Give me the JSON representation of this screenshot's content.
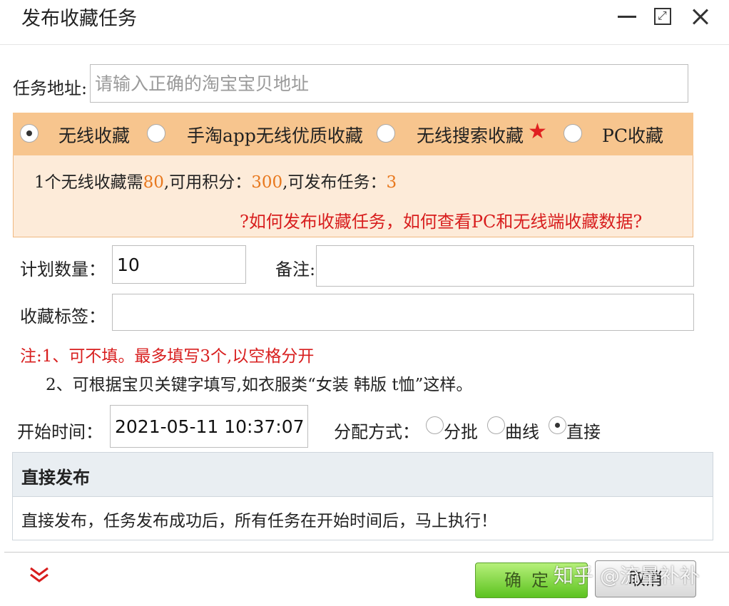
{
  "window": {
    "title": "发布收藏任务",
    "minimize_icon": "minimize-icon",
    "maximize_icon": "maximize-icon",
    "close_icon": "close-icon"
  },
  "task_url": {
    "label": "任务地址:",
    "placeholder": "请输入正确的淘宝宝贝地址",
    "value": ""
  },
  "collect_types": {
    "options": [
      {
        "label": "无线收藏",
        "selected": true
      },
      {
        "label": "手淘app无线优质收藏",
        "selected": false
      },
      {
        "label": "无线搜索收藏",
        "selected": false,
        "badge": "star-icon"
      },
      {
        "label": "PC收藏",
        "selected": false
      }
    ]
  },
  "cost_info": {
    "prefix": "1个无线收藏需",
    "cost": "80",
    "points_label": ",可用积分：",
    "points": "300",
    "tasks_label": ",可发布任务：",
    "tasks": "3"
  },
  "help_link": "?如何发布收藏任务，如何查看PC和无线端收藏数据?",
  "plan": {
    "quantity_label": "计划数量：",
    "quantity_value": "10",
    "remark_label": "备注:",
    "remark_value": ""
  },
  "tags": {
    "label": "收藏标签：",
    "value": ""
  },
  "notes": {
    "line1": "注:1、可不填。最多填写3个,以空格分开",
    "line2": "2、可根据宝贝关键字填写,如衣服类“女装 韩版 t恤”这样。"
  },
  "schedule": {
    "start_label": "开始时间：",
    "start_value": "2021-05-11 10:37:07",
    "dist_label": "分配方式：",
    "dist_options": [
      {
        "label": "分批",
        "selected": false
      },
      {
        "label": "曲线",
        "selected": false
      },
      {
        "label": "直接",
        "selected": true
      }
    ]
  },
  "description": {
    "title": "直接发布",
    "text": "直接发布，任务发布成功后，所有任务在开始时间后，马上执行！"
  },
  "footer": {
    "expand_icon": "double-chevron-down-icon",
    "ok_label": "确定",
    "cancel_label": "取消",
    "watermark": "知乎 @流量补补"
  },
  "colors": {
    "accent_orange": "#e8781e",
    "link_red": "#d81e1e",
    "panel_bg": "#fdebd9",
    "panel_bar": "#f7c58e",
    "ok_green": "#5cc21f"
  }
}
